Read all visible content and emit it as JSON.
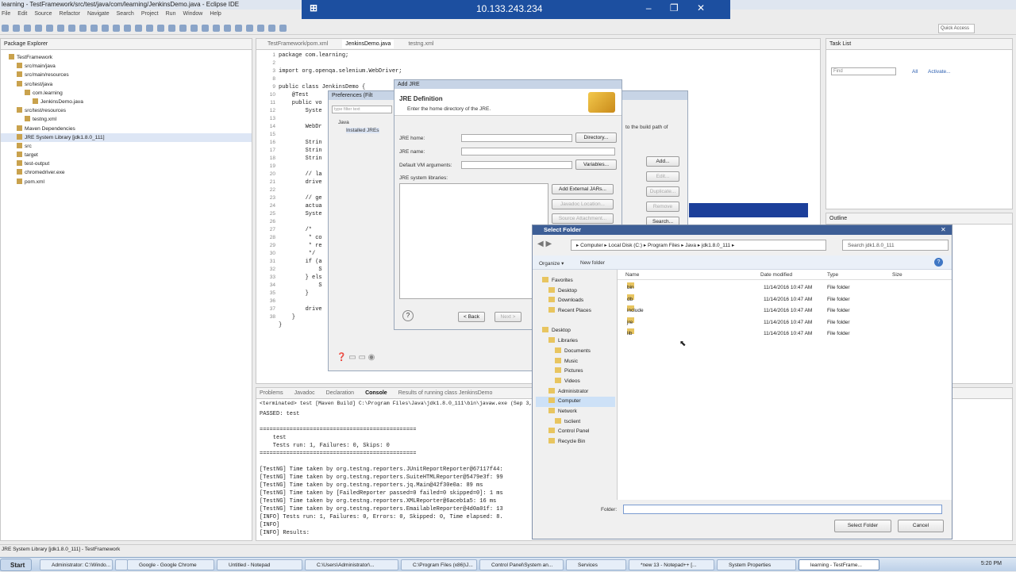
{
  "window": {
    "title": "learning - TestFramework/src/test/java/com/learning/JenkinsDemo.java - Eclipse IDE"
  },
  "rdp": {
    "ip": "10.133.243.234",
    "pin": "⊞",
    "controls": "‒ ❐ ✕"
  },
  "menu": [
    "File",
    "Edit",
    "Source",
    "Refactor",
    "Navigate",
    "Search",
    "Project",
    "Run",
    "Window",
    "Help"
  ],
  "quick_access": "Quick Access",
  "package_explorer": {
    "title": "Package Explorer",
    "items": [
      {
        "label": "TestFramework",
        "indent": 1
      },
      {
        "label": "src/main/java",
        "indent": 2
      },
      {
        "label": "src/main/resources",
        "indent": 2
      },
      {
        "label": "src/test/java",
        "indent": 2
      },
      {
        "label": "com.learning",
        "indent": 3
      },
      {
        "label": "JenkinsDemo.java",
        "indent": 4
      },
      {
        "label": "src/test/resources",
        "indent": 2
      },
      {
        "label": "testng.xml",
        "indent": 3
      },
      {
        "label": "Maven Dependencies",
        "indent": 2
      },
      {
        "label": "JRE System Library [jdk1.8.0_111]",
        "indent": 2,
        "selected": true
      },
      {
        "label": "src",
        "indent": 2
      },
      {
        "label": "target",
        "indent": 2
      },
      {
        "label": "test-output",
        "indent": 2
      },
      {
        "label": "chromedriver.exe",
        "indent": 2
      },
      {
        "label": "pom.xml",
        "indent": 2
      }
    ]
  },
  "editor": {
    "tabs": [
      "TestFramework/pom.xml",
      "JenkinsDemo.java",
      "testng.xml"
    ],
    "line_numbers": [
      "1",
      "2",
      "3",
      "8",
      "9",
      "10",
      "11",
      "12",
      "13",
      "14",
      "15",
      "16",
      "17",
      "18",
      "19",
      "20",
      "21",
      "22",
      "23",
      "24",
      "25",
      "26",
      "27",
      "28",
      "29",
      "30",
      "31",
      "32",
      "33",
      "34",
      "35",
      "36",
      "37",
      "38"
    ],
    "code": [
      "package com.learning;",
      "",
      "import org.openqa.selenium.WebDriver;",
      "",
      "public class JenkinsDemo {",
      "    @Test",
      "    public vo",
      "        Syste",
      "",
      "        WebDr",
      "",
      "        Strin",
      "        Strin",
      "        Strin",
      "",
      "        // la",
      "        drive",
      "",
      "        // ge",
      "        actua",
      "        Syste",
      "",
      "        /*",
      "         * co",
      "         * re",
      "         */",
      "        if (a",
      "            S",
      "        } els",
      "            S",
      "        }",
      "",
      "        drive",
      "    }",
      "}",
      ""
    ]
  },
  "task_list": {
    "title": "Task List",
    "find_placeholder": "Find",
    "all": "All",
    "activate": "Activate..."
  },
  "outline": {
    "title": "Outline"
  },
  "console": {
    "tabs": [
      "Problems",
      "Javadoc",
      "Declaration",
      "Console",
      "Results of running class JenkinsDemo"
    ],
    "header": "<terminated> test [Maven Build] C:\\Program Files\\Java\\jdk1.8.0_111\\bin\\javaw.exe (Sep 3, 2018, 5:08:44",
    "lines": [
      "PASSED: test",
      "",
      "===============================================",
      "    test",
      "    Tests run: 1, Failures: 0, Skips: 0",
      "===============================================",
      "",
      "[TestNG] Time taken by org.testng.reporters.JUnitReportReporter@67117f44:",
      "[TestNG] Time taken by org.testng.reporters.SuiteHTMLReporter@5479e3f: 99",
      "[TestNG] Time taken by org.testng.reporters.jq.Main@42f30e0a: 89 ms",
      "[TestNG] Time taken by [FailedReporter passed=0 failed=0 skipped=0]: 1 ms",
      "[TestNG] Time taken by org.testng.reporters.XMLReporter@6aceb1a5: 16 ms",
      "[TestNG] Time taken by org.testng.reporters.EmailableReporter@4d0a01f: 13",
      "[INFO] Tests run: 1, Failures: 0, Errors: 0, Skipped: 0, Time elapsed: 8.",
      "[INFO]",
      "[INFO] Results:"
    ]
  },
  "preferences": {
    "title": "Preferences (Filt",
    "filter_placeholder": "type filter text",
    "tree": [
      "Java",
      "Installed JREs"
    ],
    "desc": "to the build path of"
  },
  "add_jre": {
    "title": "Add JRE",
    "heading": "JRE Definition",
    "sub": "Enter the home directory of the JRE.",
    "jre_home": "JRE home:",
    "jre_name": "JRE name:",
    "vm_args": "Default VM arguments:",
    "libs": "JRE system libraries:",
    "directory": "Directory...",
    "variables": "Variables...",
    "add_external": "Add External JARs...",
    "javadoc": "Javadoc Location...",
    "source": "Source Attachment...",
    "back": "< Back",
    "next": "Next >",
    "side_buttons": [
      "Add...",
      "Edit...",
      "Duplicate...",
      "Remove",
      "Search..."
    ]
  },
  "select_folder": {
    "title": "Select Folder",
    "path": "▸ Computer ▸ Local Disk (C:) ▸ Program Files ▸ Java ▸ jdk1.8.0_111 ▸",
    "search_placeholder": "Search jdk1.8.0_111",
    "organize": "Organize ▾",
    "new_folder": "New folder",
    "columns": [
      "Name",
      "Date modified",
      "Type",
      "Size"
    ],
    "nav": [
      {
        "label": "Favorites",
        "indent": 1
      },
      {
        "label": "Desktop",
        "indent": 2
      },
      {
        "label": "Downloads",
        "indent": 2
      },
      {
        "label": "Recent Places",
        "indent": 2
      },
      {
        "label": "",
        "indent": 0
      },
      {
        "label": "Desktop",
        "indent": 1
      },
      {
        "label": "Libraries",
        "indent": 2
      },
      {
        "label": "Documents",
        "indent": 3
      },
      {
        "label": "Music",
        "indent": 3
      },
      {
        "label": "Pictures",
        "indent": 3
      },
      {
        "label": "Videos",
        "indent": 3
      },
      {
        "label": "Administrator",
        "indent": 2
      },
      {
        "label": "Computer",
        "indent": 2,
        "selected": true
      },
      {
        "label": "Network",
        "indent": 2
      },
      {
        "label": "tsclient",
        "indent": 3
      },
      {
        "label": "Control Panel",
        "indent": 2
      },
      {
        "label": "Recycle Bin",
        "indent": 2
      }
    ],
    "rows": [
      {
        "name": "bin",
        "date": "11/14/2016 10:47 AM",
        "type": "File folder"
      },
      {
        "name": "db",
        "date": "11/14/2016 10:47 AM",
        "type": "File folder"
      },
      {
        "name": "include",
        "date": "11/14/2016 10:47 AM",
        "type": "File folder"
      },
      {
        "name": "jre",
        "date": "11/14/2016 10:47 AM",
        "type": "File folder"
      },
      {
        "name": "lib",
        "date": "11/14/2016 10:47 AM",
        "type": "File folder"
      }
    ],
    "folder_label": "Folder:",
    "ok": "Select Folder",
    "cancel": "Cancel"
  },
  "status": "JRE System Library [jdk1.8.0_111] - TestFramework",
  "taskbar": {
    "start": "Start",
    "items": [
      "Administrator: C:\\Windo...",
      "",
      "Google - Google Chrome",
      "Untitled - Notepad",
      "C:\\Users\\Administrator\\...",
      "C:\\Program Files (x86)\\J...",
      "Control Panel\\System an...",
      "Services",
      "*new 13 - Notepad++ [...",
      "System Properties",
      "learning - TestFrame..."
    ],
    "clock": "5:20 PM"
  }
}
